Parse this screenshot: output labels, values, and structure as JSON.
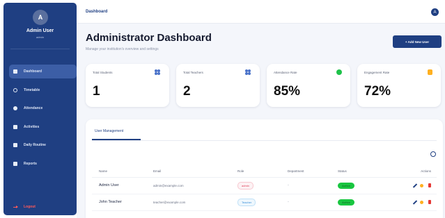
{
  "sidebar": {
    "avatar_letter": "A",
    "user_name": "Admin User",
    "user_role": "admin",
    "items": [
      {
        "label": "Dashboard",
        "icon": "dashboard-icon",
        "active": true
      },
      {
        "label": "Timetable",
        "icon": "clock-icon",
        "active": false
      },
      {
        "label": "Attendance",
        "icon": "check-circle-icon",
        "active": false
      },
      {
        "label": "Activities",
        "icon": "calendar-icon",
        "active": false
      },
      {
        "label": "Daily Routine",
        "icon": "calendar-day-icon",
        "active": false
      },
      {
        "label": "Reports",
        "icon": "report-icon",
        "active": false
      }
    ],
    "logout_label": "Logout"
  },
  "topbar": {
    "breadcrumb": "Dashboard",
    "avatar_letter": "A"
  },
  "header": {
    "title": "Administrator Dashboard",
    "subtitle": "Manage your institution's overview and settings",
    "add_button": "+ Add New User"
  },
  "stats": [
    {
      "label": "Total Students",
      "value": "1",
      "icon": "users-icon",
      "color": "#4a72c9"
    },
    {
      "label": "Total Teachers",
      "value": "2",
      "icon": "teachers-icon",
      "color": "#4a72c9"
    },
    {
      "label": "Attendance Rate",
      "value": "85%",
      "icon": "attendance-icon",
      "color": "#1ec24a"
    },
    {
      "label": "Engagement Rate",
      "value": "72%",
      "icon": "engagement-icon",
      "color": "#ffb020"
    }
  ],
  "user_management": {
    "tab_label": "User Management",
    "columns": [
      "Name",
      "Email",
      "Role",
      "Department",
      "Status",
      "Actions"
    ],
    "rows": [
      {
        "name": "Admin User",
        "email": "admin@example.com",
        "role": "admin",
        "department": "-",
        "status": "Active"
      },
      {
        "name": "John Teacher",
        "email": "teacher@example.com",
        "role": "Teacher",
        "department": "-",
        "status": "Active"
      }
    ]
  },
  "colors": {
    "brand": "#1f3f82",
    "active_status": "#19c640",
    "danger": "#e53935"
  }
}
